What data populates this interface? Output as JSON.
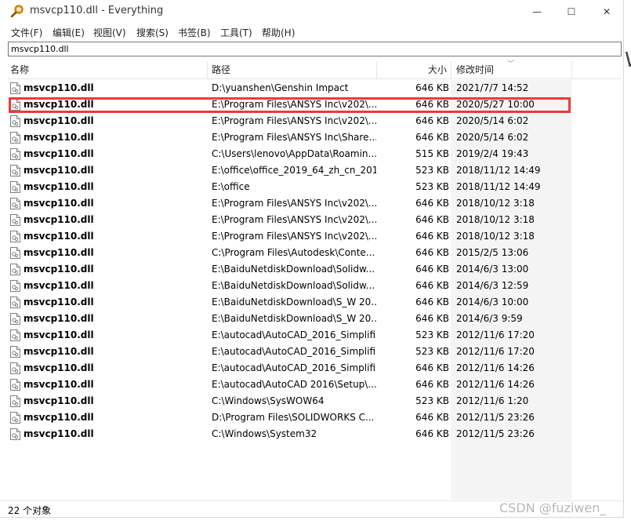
{
  "window": {
    "title": "msvcp110.dll - Everything",
    "controls": [
      "—",
      "☐",
      "✕"
    ]
  },
  "menu": [
    "文件(F)",
    "编辑(E)",
    "视图(V)",
    "搜索(S)",
    "书签(B)",
    "工具(T)",
    "帮助(H)"
  ],
  "search": {
    "value": "msvcp110.dll"
  },
  "columns": {
    "name": "名称",
    "path": "路径",
    "size": "大小",
    "modified": "修改时间"
  },
  "rows": [
    {
      "name": "msvcp110.dll",
      "path": "D:\\yuanshen\\Genshin Impact",
      "size": "646 KB",
      "modified": "2021/7/7 14:52"
    },
    {
      "name": "msvcp110.dll",
      "path": "E:\\Program Files\\ANSYS Inc\\v202\\...",
      "size": "646 KB",
      "modified": "2020/5/27 10:00"
    },
    {
      "name": "msvcp110.dll",
      "path": "E:\\Program Files\\ANSYS Inc\\v202\\...",
      "size": "646 KB",
      "modified": "2020/5/14 6:02"
    },
    {
      "name": "msvcp110.dll",
      "path": "E:\\Program Files\\ANSYS Inc\\Share...",
      "size": "646 KB",
      "modified": "2020/5/14 6:02"
    },
    {
      "name": "msvcp110.dll",
      "path": "C:\\Users\\lenovo\\AppData\\Roamin...",
      "size": "515 KB",
      "modified": "2019/2/4 19:43"
    },
    {
      "name": "msvcp110.dll",
      "path": "E:\\office\\office_2019_64_zh_cn_201...",
      "size": "523 KB",
      "modified": "2018/11/12 14:49"
    },
    {
      "name": "msvcp110.dll",
      "path": "E:\\office",
      "size": "523 KB",
      "modified": "2018/11/12 14:49"
    },
    {
      "name": "msvcp110.dll",
      "path": "E:\\Program Files\\ANSYS Inc\\v202\\...",
      "size": "646 KB",
      "modified": "2018/10/12 3:18"
    },
    {
      "name": "msvcp110.dll",
      "path": "E:\\Program Files\\ANSYS Inc\\v202\\...",
      "size": "646 KB",
      "modified": "2018/10/12 3:18"
    },
    {
      "name": "msvcp110.dll",
      "path": "E:\\Program Files\\ANSYS Inc\\v202\\...",
      "size": "646 KB",
      "modified": "2018/10/12 3:18"
    },
    {
      "name": "msvcp110.dll",
      "path": "C:\\Program Files\\Autodesk\\Conte...",
      "size": "646 KB",
      "modified": "2015/2/5 13:06"
    },
    {
      "name": "msvcp110.dll",
      "path": "E:\\BaiduNetdiskDownload\\Solidw...",
      "size": "646 KB",
      "modified": "2014/6/3 13:00"
    },
    {
      "name": "msvcp110.dll",
      "path": "E:\\BaiduNetdiskDownload\\Solidw...",
      "size": "646 KB",
      "modified": "2014/6/3 12:59"
    },
    {
      "name": "msvcp110.dll",
      "path": "E:\\BaiduNetdiskDownload\\S_W 20...",
      "size": "646 KB",
      "modified": "2014/6/3 10:00"
    },
    {
      "name": "msvcp110.dll",
      "path": "E:\\BaiduNetdiskDownload\\S_W 20...",
      "size": "646 KB",
      "modified": "2014/6/3 9:59"
    },
    {
      "name": "msvcp110.dll",
      "path": "E:\\autocad\\AutoCAD_2016_Simplifi...",
      "size": "523 KB",
      "modified": "2012/11/6 17:20"
    },
    {
      "name": "msvcp110.dll",
      "path": "E:\\autocad\\AutoCAD_2016_Simplifi...",
      "size": "523 KB",
      "modified": "2012/11/6 17:20"
    },
    {
      "name": "msvcp110.dll",
      "path": "E:\\autocad\\AutoCAD_2016_Simplifi...",
      "size": "646 KB",
      "modified": "2012/11/6 14:26"
    },
    {
      "name": "msvcp110.dll",
      "path": "E:\\autocad\\AutoCAD 2016\\Setup\\...",
      "size": "646 KB",
      "modified": "2012/11/6 14:26"
    },
    {
      "name": "msvcp110.dll",
      "path": "C:\\Windows\\SysWOW64",
      "size": "523 KB",
      "modified": "2012/11/6 1:20"
    },
    {
      "name": "msvcp110.dll",
      "path": "D:\\Program Files\\SOLIDWORKS C...",
      "size": "646 KB",
      "modified": "2012/11/5 23:26"
    },
    {
      "name": "msvcp110.dll",
      "path": "C:\\Windows\\System32",
      "size": "646 KB",
      "modified": "2012/11/5 23:26"
    }
  ],
  "status": "22 个对象",
  "watermark": "CSDN @fuziwen_",
  "side_sliver": "W",
  "colors": {
    "highlight": "#ef3939",
    "sorted_column": "#f4f4f4"
  }
}
